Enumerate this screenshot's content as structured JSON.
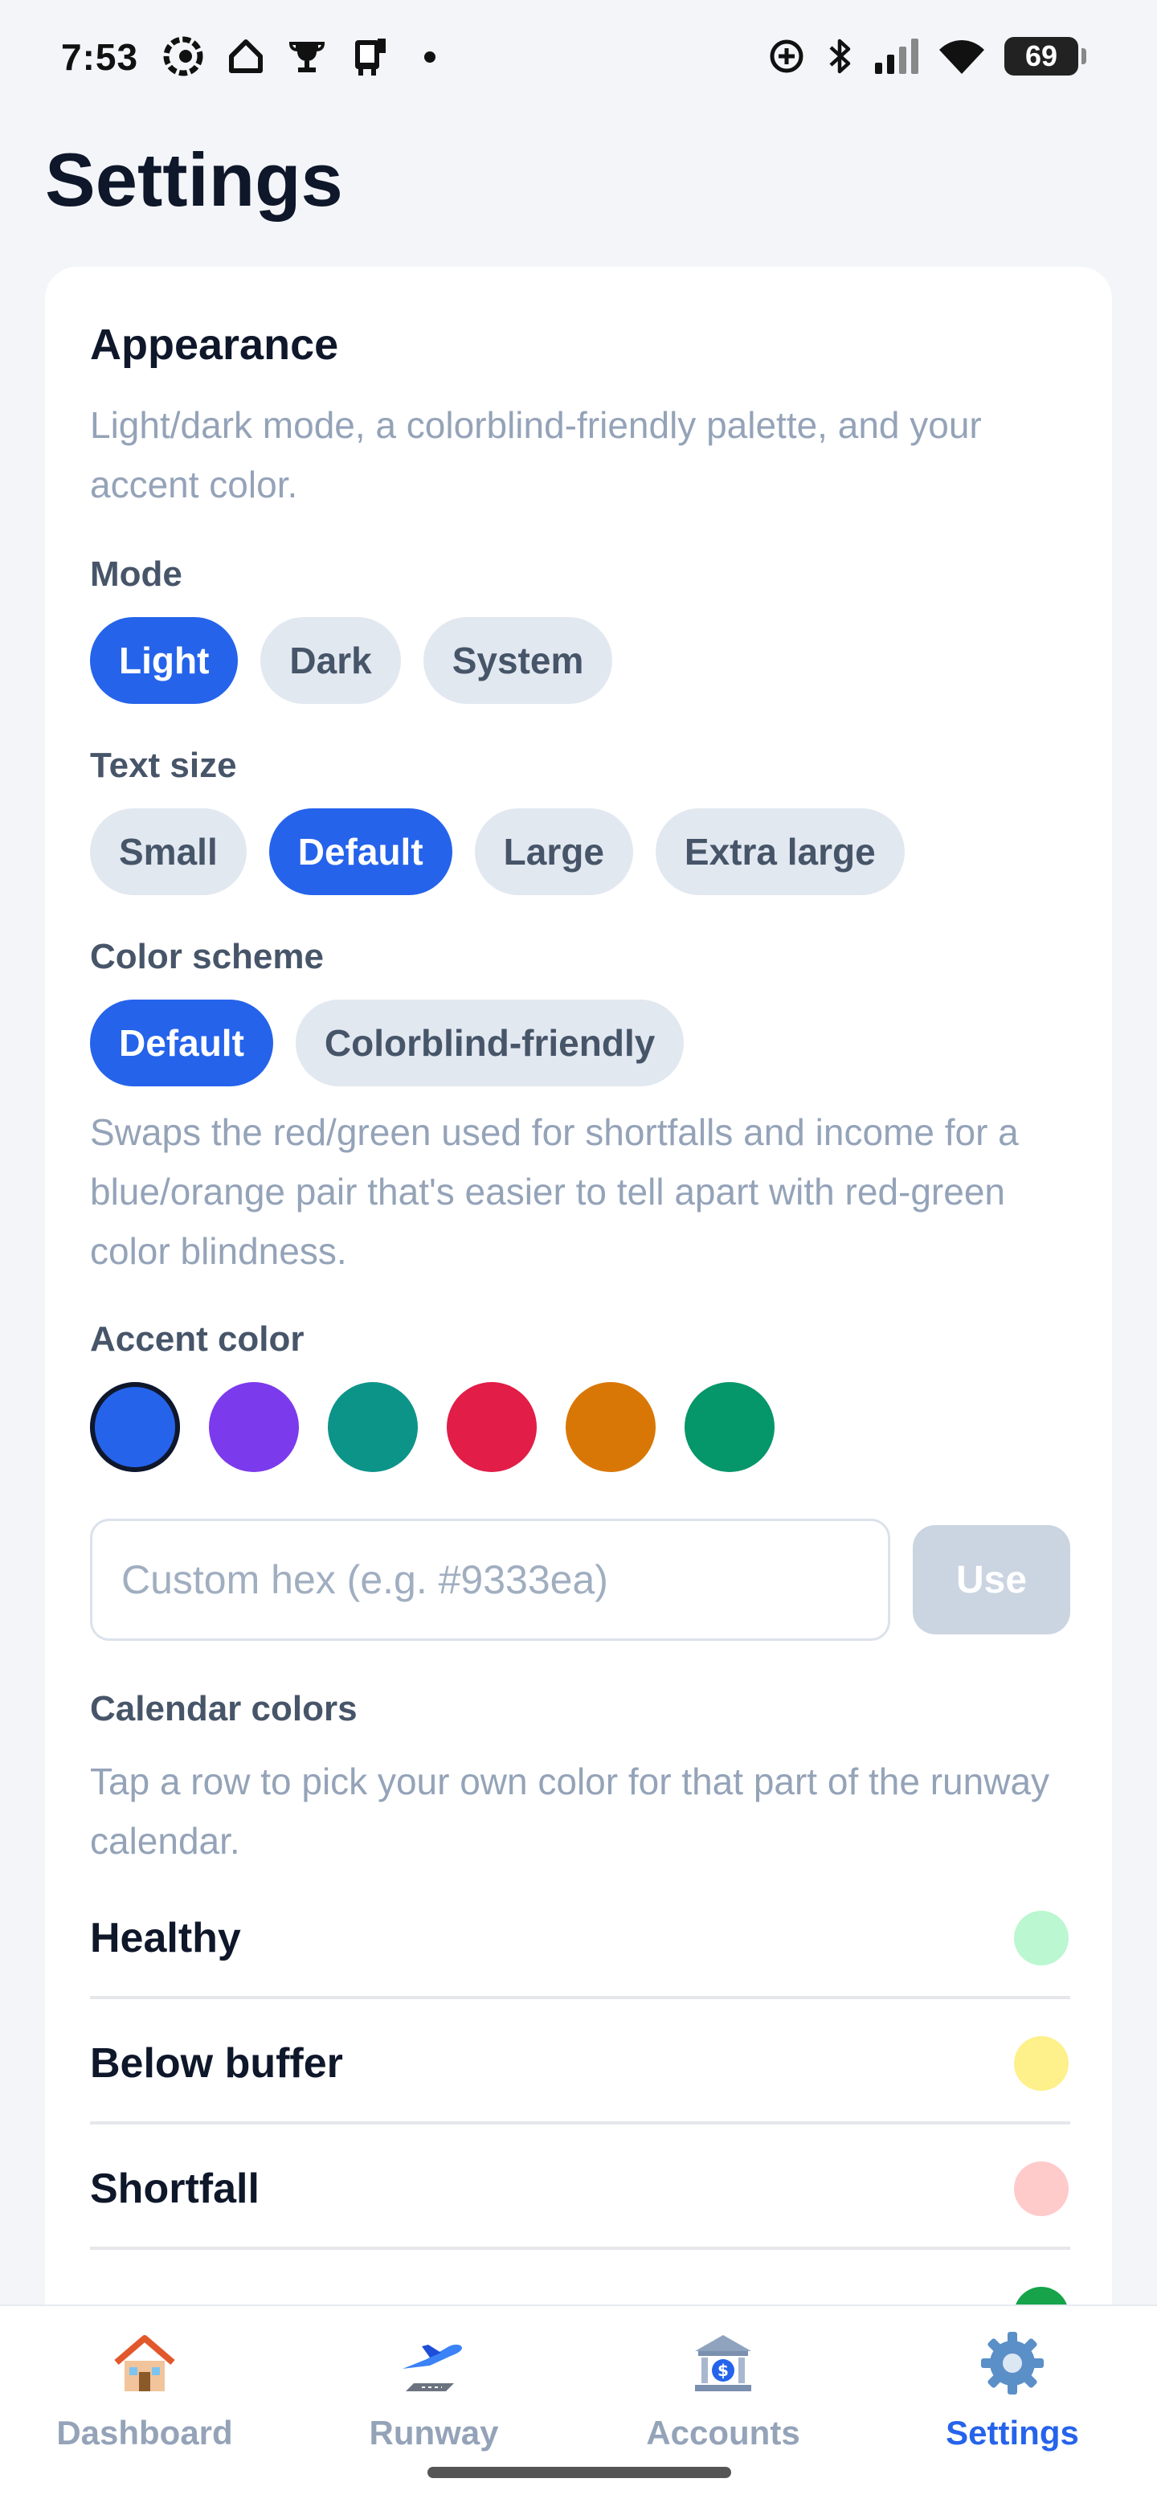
{
  "status_bar": {
    "time": "7:53",
    "battery": "69",
    "left_icons": [
      "app-icon",
      "home-icon",
      "trophy-icon",
      "device-icon"
    ],
    "right_icons": [
      "sync-icon",
      "bluetooth-icon",
      "signal-icon",
      "wifi-icon",
      "battery-icon"
    ]
  },
  "page_title": "Settings",
  "appearance": {
    "title": "Appearance",
    "description": "Light/dark mode, a colorblind-friendly palette, and your accent color.",
    "mode": {
      "label": "Mode",
      "options": [
        "Light",
        "Dark",
        "System"
      ],
      "selected": "Light"
    },
    "text_size": {
      "label": "Text size",
      "options": [
        "Small",
        "Default",
        "Large",
        "Extra large"
      ],
      "selected": "Default"
    },
    "color_scheme": {
      "label": "Color scheme",
      "options": [
        "Default",
        "Colorblind-friendly"
      ],
      "selected": "Default",
      "note": "Swaps the red/green used for shortfalls and income for a blue/orange pair that's easier to tell apart with red-green color blindness."
    },
    "accent_color": {
      "label": "Accent color",
      "swatches": [
        "#2563eb",
        "#7c3aed",
        "#0d9488",
        "#e11d48",
        "#d97706",
        "#059669"
      ],
      "selected_index": 0,
      "custom_hex_value": "",
      "custom_hex_placeholder": "Custom hex (e.g. #9333ea)",
      "use_button": "Use"
    },
    "calendar_colors": {
      "label": "Calendar colors",
      "description": "Tap a row to pick your own color for that part of the runway calendar.",
      "rows": [
        {
          "name": "Healthy",
          "color": "#bbf7d0"
        },
        {
          "name": "Below buffer",
          "color": "#fef08a"
        },
        {
          "name": "Shortfall",
          "color": "#fecaca"
        },
        {
          "name": "",
          "color": "#16a34a"
        }
      ]
    }
  },
  "bottom_nav": {
    "items": [
      {
        "label": "Dashboard",
        "icon": "house-icon"
      },
      {
        "label": "Runway",
        "icon": "airplane-icon"
      },
      {
        "label": "Accounts",
        "icon": "bank-icon"
      },
      {
        "label": "Settings",
        "icon": "gear-icon"
      }
    ],
    "active": "Settings"
  },
  "colors": {
    "accent": "#2563eb",
    "chip_inactive": "#e2e8f0",
    "muted_text": "#94a3b8"
  }
}
